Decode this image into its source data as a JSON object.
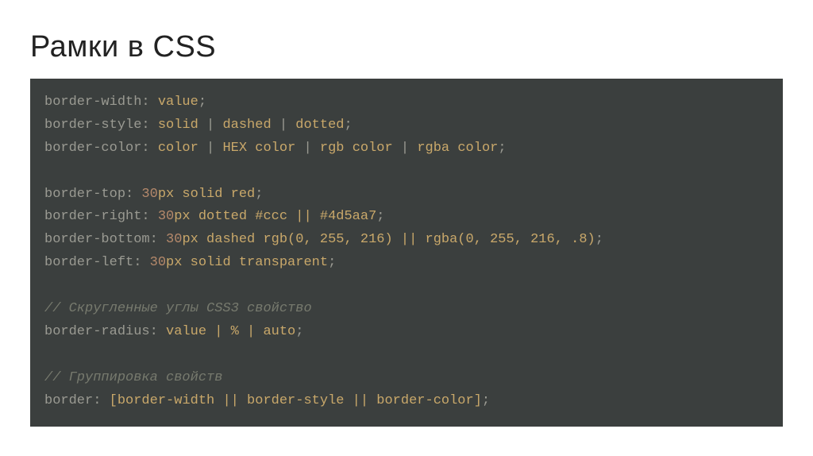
{
  "title": "Рамки в CSS",
  "code": {
    "l1": {
      "prop": "border-width:",
      "val": "value",
      "end": ";"
    },
    "l2": {
      "prop": "border-style:",
      "v1": "solid",
      "sep1": " | ",
      "v2": "dashed",
      "sep2": " | ",
      "v3": "dotted",
      "end": ";"
    },
    "l3": {
      "prop": "border-color:",
      "v1": "color",
      "sep1": " | ",
      "v2": "HEX color",
      "sep2": " | ",
      "v3": "rgb color",
      "sep3": " | ",
      "v4": "rgba color",
      "end": ";"
    },
    "l5": {
      "prop": "border-top:",
      "num": "30",
      "rest": "px solid red",
      "end": ";"
    },
    "l6": {
      "prop": "border-right:",
      "num": "30",
      "rest": "px dotted #ccc || #4d5aa7",
      "end": ";"
    },
    "l7": {
      "prop": "border-bottom:",
      "num": "30",
      "rest": "px dashed rgb(0, 255, 216) || rgba(0, 255, 216, .8)",
      "end": ";"
    },
    "l8": {
      "prop": "border-left:",
      "num": "30",
      "rest": "px solid transparent",
      "end": ";"
    },
    "c1": "// Скругленные углы CSS3 свойство",
    "l10": {
      "prop": "border-radius:",
      "val": "value | % | auto",
      "end": ";"
    },
    "c2": "// Группировка свойств",
    "l12": {
      "prop": "border:",
      "val": "[border-width || border-style || border-color]",
      "end": ";"
    }
  }
}
